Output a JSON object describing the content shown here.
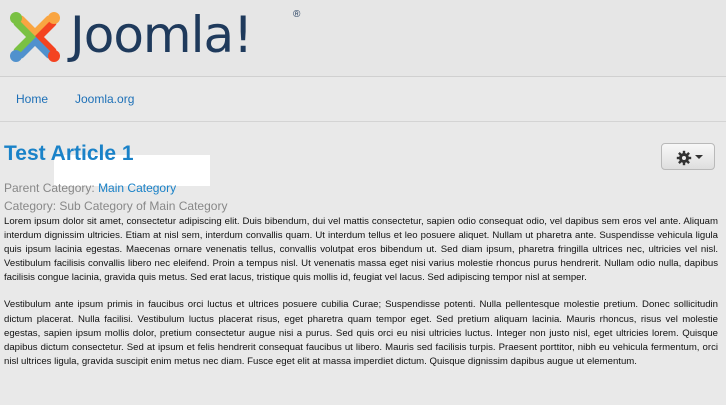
{
  "logo": {
    "wordmark": "Joomla!",
    "registered_mark": "®"
  },
  "nav": {
    "items": [
      {
        "label": "Home"
      },
      {
        "label": "Joomla.org"
      }
    ]
  },
  "article": {
    "title": "Test Article 1",
    "parent_label": "Parent Category: ",
    "parent_value": "Main Category",
    "category_label": "Category: ",
    "category_value": "Sub Category of Main Category",
    "paragraphs": [
      "Lorem ipsum dolor sit amet, consectetur adipiscing elit. Duis bibendum, dui vel mattis consectetur, sapien odio consequat odio, vel dapibus sem eros vel ante. Aliquam interdum dignissim ultricies. Etiam at nisl sem, interdum convallis quam. Ut interdum tellus et leo posuere aliquet. Nullam ut pharetra ante. Suspendisse vehicula ligula quis ipsum lacinia egestas. Maecenas ornare venenatis tellus, convallis volutpat eros bibendum ut. Sed diam ipsum, pharetra fringilla ultrices nec, ultricies vel nisl. Vestibulum facilisis convallis libero nec eleifend. Proin a tempus nisl. Ut venenatis massa eget nisi varius molestie rhoncus purus hendrerit. Nullam odio nulla, dapibus facilisis congue lacinia, gravida quis metus. Sed erat lacus, tristique quis mollis id, feugiat vel lacus. Sed adipiscing tempor nisl at semper.",
      "Vestibulum ante ipsum primis in faucibus orci luctus et ultrices posuere cubilia Curae; Suspendisse potenti. Nulla pellentesque molestie pretium. Donec sollicitudin dictum placerat. Nulla facilisi. Vestibulum luctus placerat risus, eget pharetra quam tempor eget. Sed pretium aliquam lacinia. Mauris rhoncus, risus vel molestie egestas, sapien ipsum mollis dolor, pretium consectetur augue nisi a purus. Sed quis orci eu nisi ultricies luctus. Integer non justo nisl, eget ultricies lorem. Quisque dapibus dictum consectetur. Sed at ipsum et felis hendrerit consequat faucibus ut libero. Mauris sed facilisis turpis. Praesent porttitor, nibh eu vehicula fermentum, orci nisl ultrices ligula, gravida suscipit enim metus nec diam. Fusce eget elit at massa imperdiet dictum. Quisque dignissim dapibus augue ut elementum."
    ]
  },
  "tools": {
    "icon": "gear-icon"
  },
  "colors": {
    "link": "#1a82c8",
    "logo_navy": "#1f3a5c",
    "background": "#e9e9e9"
  }
}
